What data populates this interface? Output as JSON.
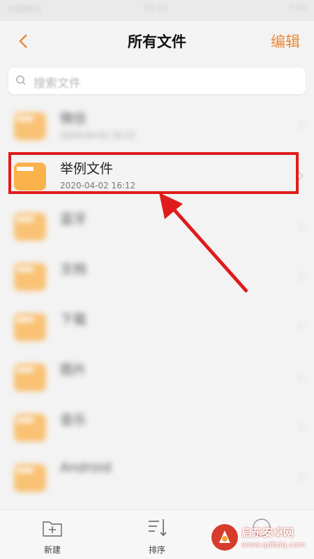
{
  "status_bar": {
    "left": "中国移动",
    "time": "16:13",
    "right": "74%"
  },
  "header": {
    "title": "所有文件",
    "edit_label": "编辑"
  },
  "search": {
    "placeholder": "搜索文件"
  },
  "files": [
    {
      "name": "微信",
      "date": "2020-04-02 16:12",
      "blurred": true
    },
    {
      "name": "举例文件",
      "date": "2020-04-02 16:12",
      "blurred": false
    },
    {
      "name": "蓝牙",
      "date": "",
      "blurred": true
    },
    {
      "name": "文档",
      "date": "",
      "blurred": true
    },
    {
      "name": "下载",
      "date": "",
      "blurred": true
    },
    {
      "name": "图片",
      "date": "",
      "blurred": true
    },
    {
      "name": "音乐",
      "date": "",
      "blurred": true
    },
    {
      "name": "Android",
      "date": "",
      "blurred": true
    }
  ],
  "tabbar": {
    "new_label": "新建",
    "sort_label": "排序"
  },
  "watermark": {
    "name": "启东安卓网",
    "url": "www.qdltdq.com"
  },
  "colors": {
    "accent": "#e8893a",
    "folder": "#fbb24a",
    "highlight": "#e01b1b"
  }
}
